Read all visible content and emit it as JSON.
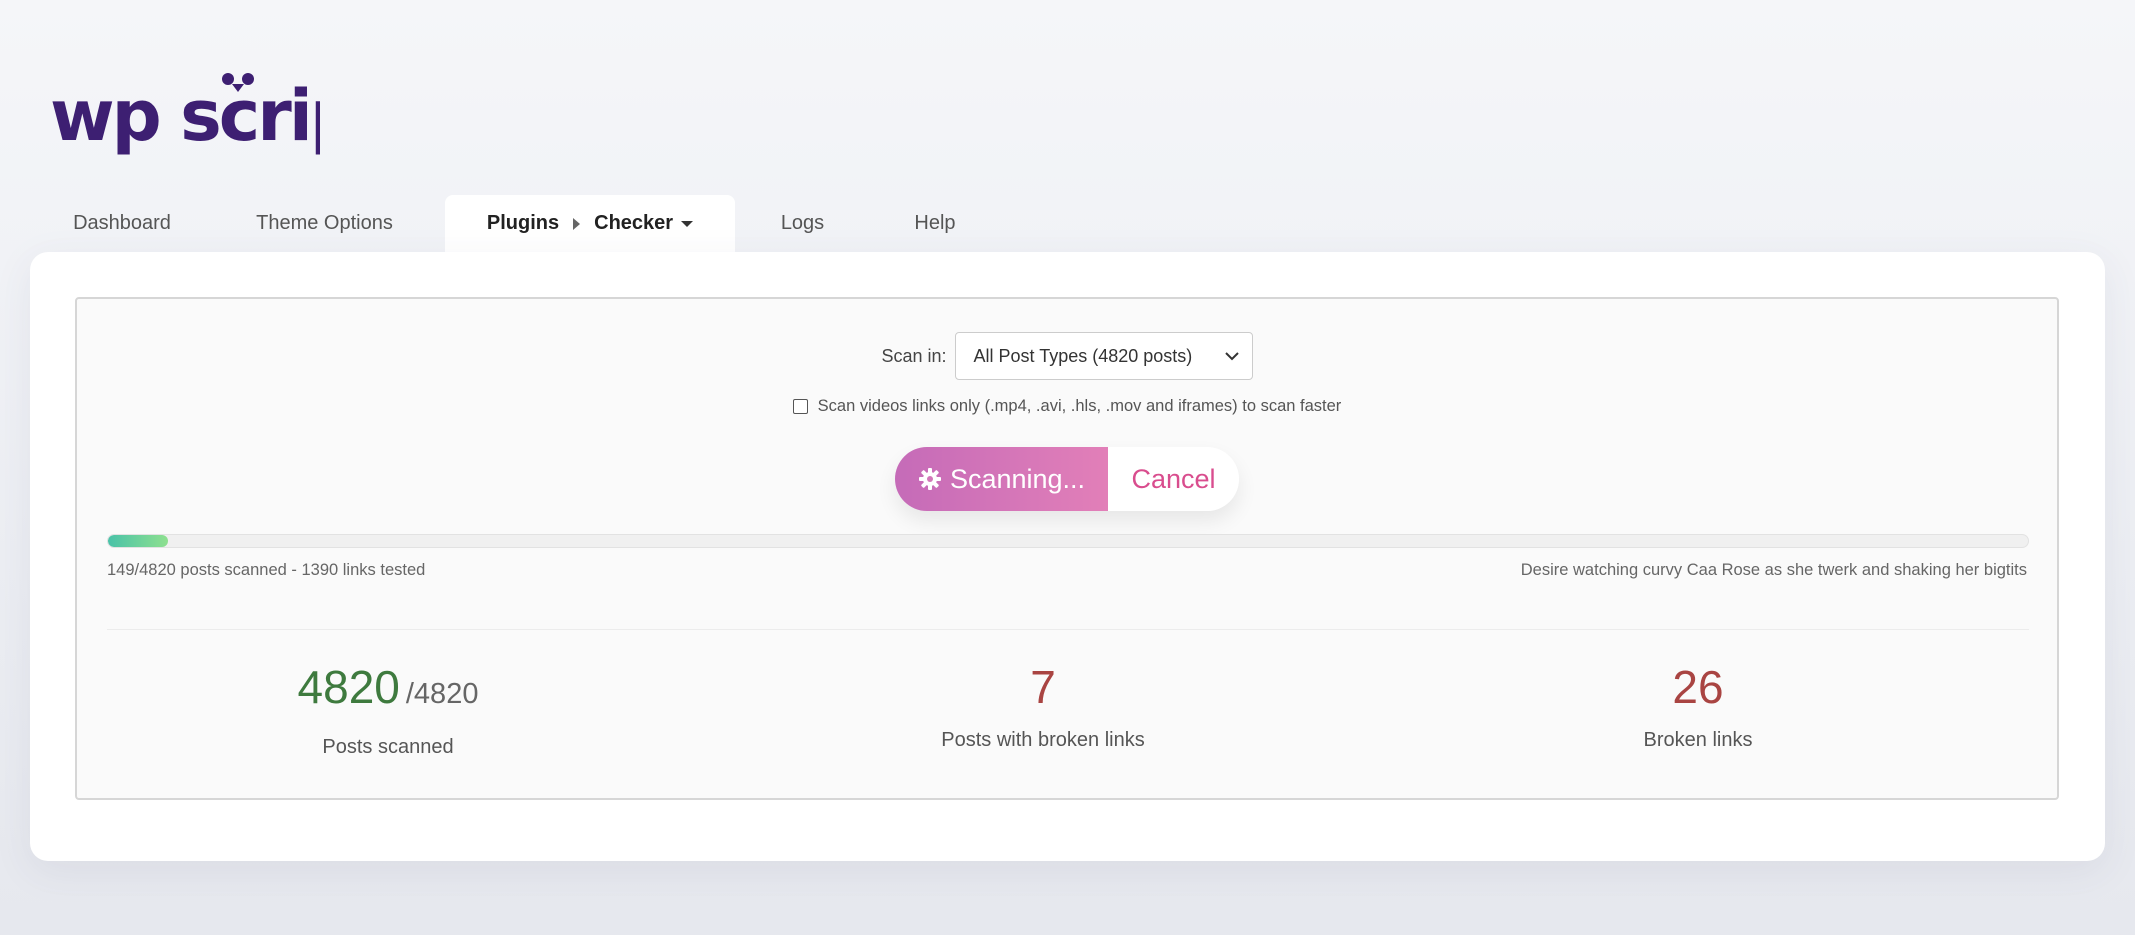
{
  "logo": {
    "text": "wp script"
  },
  "nav": {
    "tabs": [
      {
        "label": "Dashboard"
      },
      {
        "label": "Theme Options"
      },
      {
        "label": "Plugins",
        "sub": "Checker"
      },
      {
        "label": "Logs"
      },
      {
        "label": "Help"
      }
    ]
  },
  "scan": {
    "label": "Scan in:",
    "selected": "All Post Types (4820 posts)",
    "checkbox_label": "Scan videos links only (.mp4, .avi, .hls, .mov and iframes) to scan faster",
    "checkbox_checked": false
  },
  "buttons": {
    "scanning": "Scanning...",
    "cancel": "Cancel"
  },
  "progress": {
    "fraction": 0.031,
    "status": "149/4820 posts scanned - 1390 links tested",
    "current_post": "Desire watching curvy Caa Rose as she twerk and shaking her bigtits"
  },
  "stats": {
    "scanned": {
      "value": "4820",
      "total": "/4820",
      "label": "Posts scanned"
    },
    "broken_posts": {
      "value": "7",
      "label": "Posts with broken links"
    },
    "broken_links": {
      "value": "26",
      "label": "Broken links"
    }
  },
  "colors": {
    "brand": "#3d1f72",
    "accent": "#d94d8e",
    "good": "#3e7a3e",
    "bad": "#a94442"
  }
}
